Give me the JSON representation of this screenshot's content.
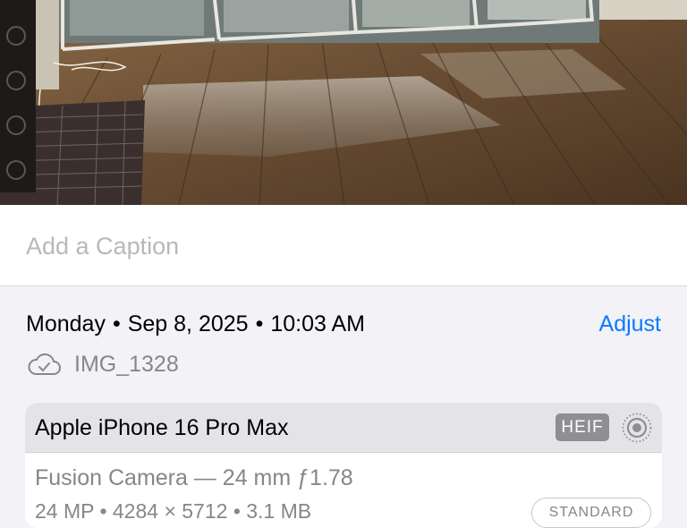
{
  "caption": {
    "placeholder": "Add a Caption"
  },
  "info": {
    "day": "Monday",
    "date": "Sep 8, 2025",
    "time": "10:03 AM",
    "separator": "•",
    "adjust_label": "Adjust",
    "file_name": "IMG_1328"
  },
  "camera": {
    "device": "Apple iPhone 16 Pro Max",
    "format_badge": "HEIF",
    "lens": "Fusion Camera — 24 mm ƒ1.78",
    "specs": "24 MP • 4284 × 5712 • 3.1 MB",
    "mode_badge": "STANDARD"
  },
  "colors": {
    "accent": "#0a7aff",
    "secondary_text": "#86868b",
    "panel_background": "#f2f2f7"
  },
  "icons": {
    "cloud": "cloud-checkmark-icon",
    "live": "live-photo-icon"
  }
}
